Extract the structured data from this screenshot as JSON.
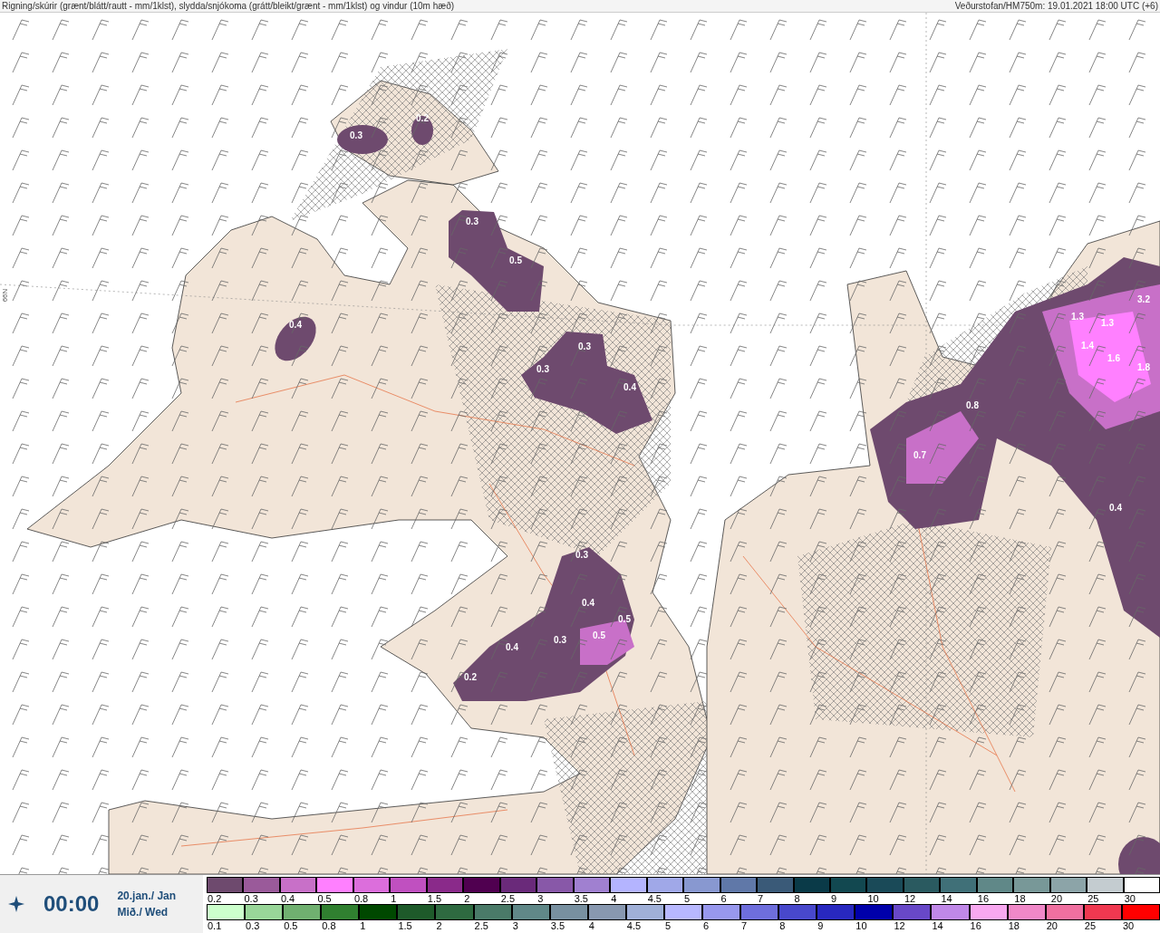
{
  "header": {
    "title": "Rigning/skúrir (grænt/blátt/rautt - mm/1klst), slydda/snjókoma (grátt/bleikt/grænt - mm/1klst) og vindur (10m hæð)",
    "source": "Veðurstofan/HM750m: 19.01.2021 18:00 UTC (+6)"
  },
  "map": {
    "latitude_label": "66N",
    "values": [
      "0.3",
      "0.2",
      "0.3",
      "0.5",
      "0.4",
      "0.3",
      "0.3",
      "0.4",
      "3.2",
      "1.3",
      "1.3",
      "1.4",
      "1.6",
      "1.8",
      "0.8",
      "0.7",
      "0.4",
      "0.3",
      "0.4",
      "0.5",
      "0.5",
      "0.4",
      "0.3",
      "0.2"
    ]
  },
  "time": {
    "clock": "00:00",
    "date": "20.jan./ Jan",
    "weekday": "Mið./ Wed"
  },
  "legend_top": [
    {
      "label": "0.2",
      "color": "#6e4a6e"
    },
    {
      "label": "0.3",
      "color": "#9a5a9a"
    },
    {
      "label": "0.4",
      "color": "#c870c8"
    },
    {
      "label": "0.5",
      "color": "#ff80ff"
    },
    {
      "label": "0.8",
      "color": "#dc6edc"
    },
    {
      "label": "1",
      "color": "#c050c0"
    },
    {
      "label": "1.5",
      "color": "#8a2a8a"
    },
    {
      "label": "2",
      "color": "#500050"
    },
    {
      "label": "2.5",
      "color": "#6a2a7a"
    },
    {
      "label": "3",
      "color": "#8858a8"
    },
    {
      "label": "3.5",
      "color": "#a080d0"
    },
    {
      "label": "4",
      "color": "#b4b4ff"
    },
    {
      "label": "4.5",
      "color": "#a0a8e8"
    },
    {
      "label": "5",
      "color": "#8898d0"
    },
    {
      "label": "6",
      "color": "#6078a8"
    },
    {
      "label": "7",
      "color": "#3a5a78"
    },
    {
      "label": "8",
      "color": "#0a3a48"
    },
    {
      "label": "9",
      "color": "#124850"
    },
    {
      "label": "10",
      "color": "#1a4a58"
    },
    {
      "label": "12",
      "color": "#2a5a60"
    },
    {
      "label": "14",
      "color": "#407078"
    },
    {
      "label": "16",
      "color": "#608888"
    },
    {
      "label": "18",
      "color": "#789898"
    },
    {
      "label": "20",
      "color": "#8ca4a8"
    },
    {
      "label": "25",
      "color": "#c4ccd0"
    },
    {
      "label": "30",
      "color": "#ffffff"
    }
  ],
  "legend_bottom": [
    {
      "label": "0.1",
      "color": "#ccffcc"
    },
    {
      "label": "0.3",
      "color": "#99d699"
    },
    {
      "label": "0.5",
      "color": "#70b070"
    },
    {
      "label": "0.8",
      "color": "#308030"
    },
    {
      "label": "1",
      "color": "#004800"
    },
    {
      "label": "1.5",
      "color": "#1e5a2a"
    },
    {
      "label": "2",
      "color": "#2e6a40"
    },
    {
      "label": "2.5",
      "color": "#4a7a68"
    },
    {
      "label": "3",
      "color": "#608888"
    },
    {
      "label": "3.5",
      "color": "#7890a0"
    },
    {
      "label": "4",
      "color": "#8898b0"
    },
    {
      "label": "4.5",
      "color": "#a0b0d8"
    },
    {
      "label": "5",
      "color": "#b8b8ff"
    },
    {
      "label": "6",
      "color": "#9898ee"
    },
    {
      "label": "7",
      "color": "#6e6edc"
    },
    {
      "label": "8",
      "color": "#4848cc"
    },
    {
      "label": "9",
      "color": "#2828c0"
    },
    {
      "label": "10",
      "color": "#0000aa"
    },
    {
      "label": "12",
      "color": "#6848c8"
    },
    {
      "label": "14",
      "color": "#c088e8"
    },
    {
      "label": "16",
      "color": "#f8a8f0"
    },
    {
      "label": "18",
      "color": "#f088c8"
    },
    {
      "label": "20",
      "color": "#f070a0"
    },
    {
      "label": "25",
      "color": "#f03850"
    },
    {
      "label": "30",
      "color": "#ff0000"
    }
  ]
}
